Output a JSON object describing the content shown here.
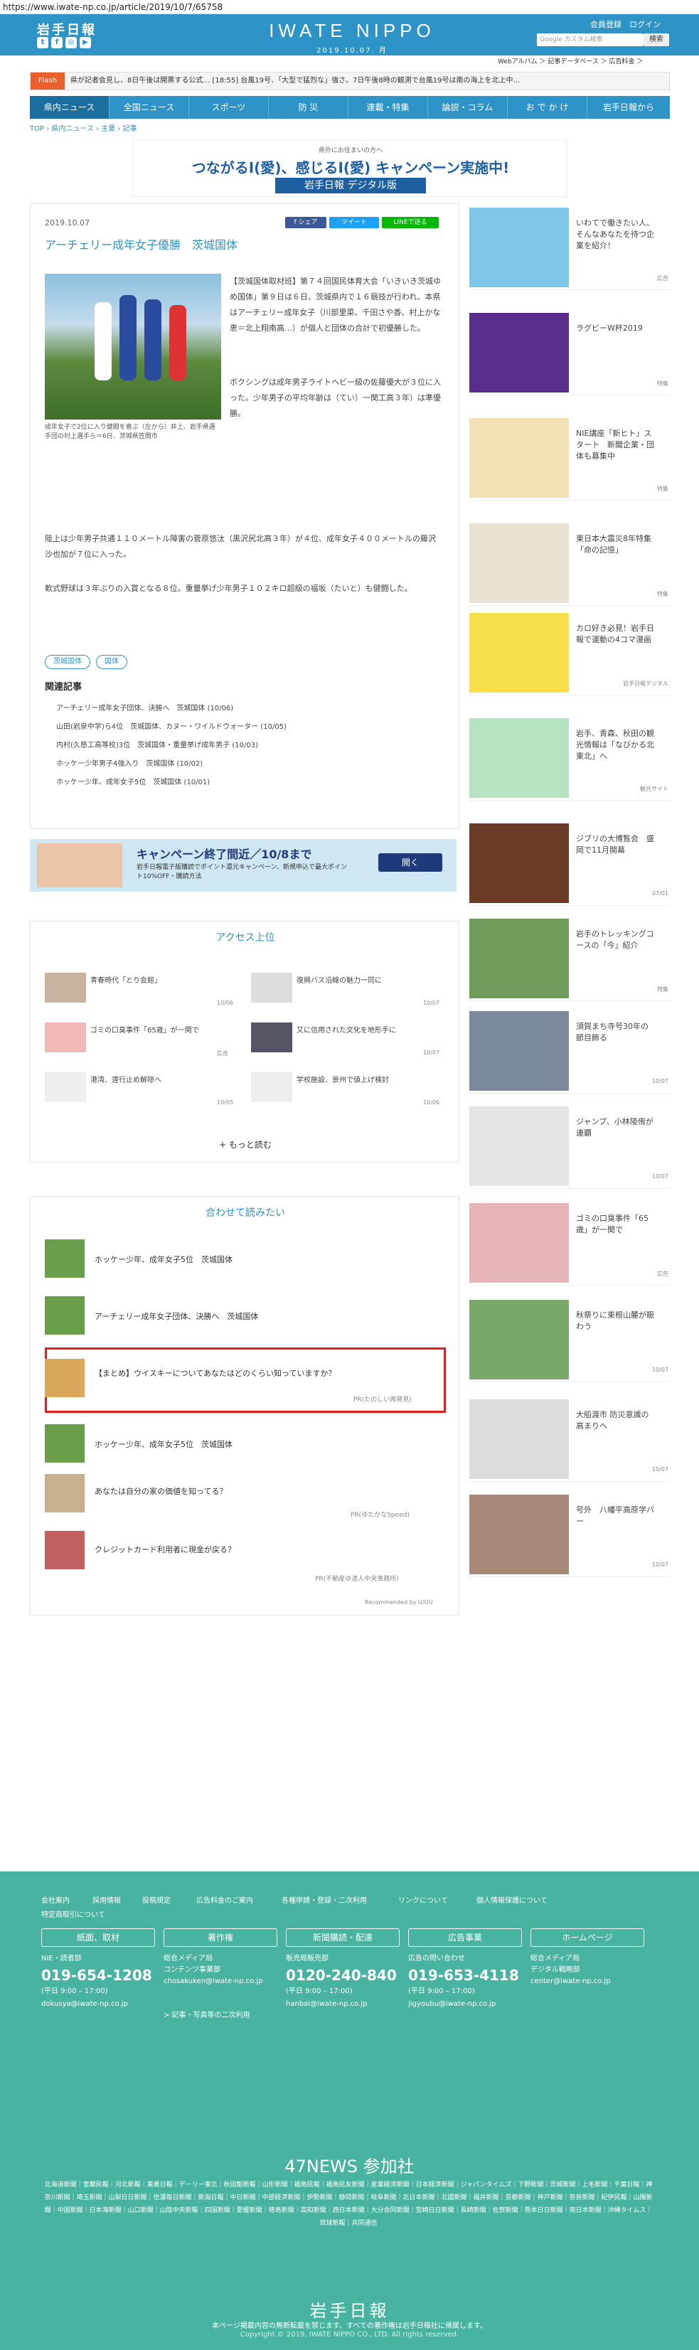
{
  "browser": {
    "url": "https://www.iwate-np.co.jp/article/2019/10/7/65758"
  },
  "header": {
    "logo": "岩手日報",
    "brand": "IWATE NIPPO",
    "date": "2019.10.07. 月",
    "member_label": "会員登録",
    "login_label": "ログイン",
    "search_placeholder": "Google カスタム検索",
    "search_button": "検索",
    "webmenu": "Webアルバム ＞ 記事データベース ＞ 広告料金 ＞"
  },
  "flash": {
    "label": "Flash",
    "text": "県が記者会見し、8日午後は開票する公式… [18:55] 台風19号、「大型で猛烈な」強さ。7日午後8時の観測で台風19号は南の海上を北上中…"
  },
  "nav": {
    "items": [
      "県内ニュース",
      "全国ニュース",
      "スポーツ",
      "防 災",
      "連載・特集",
      "論説・コラム",
      "お で か け",
      "岩手日報から"
    ]
  },
  "breadcrumb": "TOP › 県内ニュース › 主要 › 記事",
  "banner": {
    "top": "県外にお住まいの方へ",
    "main": "つながるI(愛)、感じるI(愛) キャンペーン実施中!",
    "sub": "岩手日報 デジタル版"
  },
  "article": {
    "date": "2019.10.07",
    "share_fb": "f シェア",
    "share_tw": "ツイート",
    "share_line": "LINEで送る",
    "title": "アーチェリー成年女子優勝　茨城国体",
    "caption": "成年女子で2位に入り健闘を喜ぶ（左から）井上、岩手県選手団の村上選手ら＝6日、茨城県笠間市",
    "paragraphs": [
      "【茨城国体取材班】第７４回国民体育大会「いきいき茨城ゆめ国体」第９日は６日、茨城県内で１６競技が行われ、本県はアーチェリー成年女子（川部里菜、千田さや香、村上かな恵＝北上翔南高…）が個人と団体の合計で初優勝した。",
      "ボクシングは成年男子ライトヘビー級の佐藤優大が３位に入った。少年男子の平均年齢は（てい）一関工高３年）は準優勝。",
      "陸上は少年男子共通１１０メートル障害の菅原悠汰（黒沢尻北高３年）が４位、成年女子４００メートルの藤沢沙也加が７位に入った。",
      "軟式野球は３年ぶりの入賞となる８位。重量挙げ少年男子１０２キロ超級の福坂（たいと）も健闘した。"
    ],
    "tags": [
      "茨城国体",
      "国体"
    ],
    "related_title": "関連記事",
    "related": [
      "アーチェリー成年女子団体、決勝へ　茨城国体 (10/06)",
      "山田(岩泉中学)ら4位　茨城国体、カヌー・ワイルドウォーター (10/05)",
      "内村(久慈工高等校)3位　茨城国体・重量挙げ成年男子 (10/03)",
      "ホッケー少年男子4強入り　茨城国体 (10/02)",
      "ホッケー少年、成年女子5位　茨城国体 (10/01)"
    ]
  },
  "ad": {
    "title": "キャンペーン終了間近／10/8まで",
    "text": "岩手日報電子版購読でポイント還元キャンペーン、新規申込で最大ポイント10%OFF・購読方法",
    "button": "開く"
  },
  "access": {
    "title": "アクセス上位",
    "items": [
      {
        "text": "青春時代「とり会館」",
        "date": "10/06"
      },
      {
        "text": "復興バス沿線の魅力一同に",
        "date": "10/07"
      },
      {
        "text": "ゴミの口臭事件「65歳」が一関で",
        "date": "広告"
      },
      {
        "text": "又に信用された文化を地形手に",
        "date": "10/07"
      },
      {
        "text": "港湾、遠行止め解除へ",
        "date": "10/05"
      },
      {
        "text": "学校施設、景州で値上げ検討",
        "date": "10/06"
      }
    ],
    "more": "+ もっと読む"
  },
  "recommend": {
    "title": "合わせて読みたい",
    "items": [
      {
        "text": "ホッケー少年、成年女子5位　茨城国体",
        "pr": ""
      },
      {
        "text": "アーチェリー成年女子団体、決勝へ　茨城国体",
        "pr": ""
      },
      {
        "text": "【まとめ】ウイスキーについてあなたはどのくらい知っていますか？",
        "pr": "PR(たのしい再発見)"
      },
      {
        "text": "ホッケー少年、成年女子5位　茨城国体",
        "pr": ""
      },
      {
        "text": "あなたは自分の家の価値を知ってる？",
        "pr": "PR(ゆたかなSpeed)"
      },
      {
        "text": "クレジットカード利用者に現金が戻る？",
        "pr": "PR(不動産ゆ達人中央事務所)"
      }
    ],
    "footer": "Recommended by U/OU"
  },
  "sidebar": {
    "items": [
      {
        "text": "いわてで働きたい人、そんなあなたを待つ企業を紹介！",
        "meta": "広告"
      },
      {
        "text": "ラグビーW杯2019",
        "meta": "特集"
      },
      {
        "text": "NIE講座「新ヒト」スタート　新聞企業・団体も募集中",
        "meta": "特集"
      },
      {
        "text": "東日本大震災8年特集「命の記憶」",
        "meta": "特集"
      },
      {
        "text": "カロ好き必見！岩手日報で運動の4コマ漫画",
        "meta": "岩手日報デジタル"
      },
      {
        "text": "岩手、青森、秋田の観光情報は「なびかる北東北」へ",
        "meta": "観光サイト"
      },
      {
        "text": "ジブリの大博覧会　盛岡で11月開幕",
        "meta": "07/01"
      },
      {
        "text": "岩手のトレッキングコースの「今」紹介",
        "meta": "特集"
      },
      {
        "text": "須賀まち寺号30年の節目飾る",
        "meta": "10/07"
      },
      {
        "text": "ジャンプ、小林陵侑が連覇",
        "meta": "10/07"
      },
      {
        "text": "ゴミの口臭事件「65歳」が一関で",
        "meta": "広告"
      },
      {
        "text": "秋祭りに東根山麓が賑わう",
        "meta": "10/07"
      },
      {
        "text": "大船渡市 防災意識の高まりへ",
        "meta": "10/07"
      },
      {
        "text": "号外　八幡平高原学バー",
        "meta": "10/07"
      }
    ]
  },
  "footer": {
    "links": [
      "会社案内",
      "採用情報",
      "投稿規定",
      "広告料金のご案内",
      "各種申請・登録・二次利用",
      "リンクについて",
      "個人情報保護について",
      "特定商取引について"
    ],
    "cols": [
      {
        "head": "紙面、取材",
        "l1": "NIE・読者部",
        "tel": "019-654-1208",
        "l2": "(平日 9:00 – 17:00)",
        "mail": "dokusya@iwate-np.co.jp"
      },
      {
        "head": "著作権",
        "l1": "総合メディア局",
        "tel": "コンテンツ事業部",
        "l2": "chosakuken@iwate-np.co.jp",
        "mail": "> 記事・写真等の二次利用"
      },
      {
        "head": "新聞購読・配達",
        "l1": "販売局販売部",
        "tel": "0120-240-840",
        "l2": "(平日 9:00 – 17:00)",
        "mail": "hanbai@iwate-np.co.jp"
      },
      {
        "head": "広告事業",
        "l1": "広告の問い合わせ",
        "tel": "019-653-4118",
        "l2": "(平日 9:00 – 17:00)",
        "mail": "jigyoubu@iwate-np.co.jp"
      },
      {
        "head": "ホームページ",
        "l1": "総合メディア局",
        "tel": "デジタル戦略部",
        "l2": "center@iwate-np.co.jp",
        "mail": ""
      }
    ],
    "n47": "47NEWS 参加社",
    "n47list": "北海道新聞｜室蘭民報｜河北新報｜東奥日報｜デーリー東北｜秋田魁新報｜山形新聞｜福島民報｜福島民友新聞｜産業経済新聞｜日本経済新聞｜ジャパンタイムズ｜下野新聞｜茨城新聞｜上毛新聞｜千葉日報｜神奈川新聞｜埼玉新聞｜山梨日日新聞｜信濃毎日新聞｜新潟日報｜中日新聞｜中部経済新聞｜伊勢新聞｜静岡新聞｜岐阜新聞｜北日本新聞｜北國新聞｜福井新聞｜京都新聞｜神戸新聞｜奈良新聞｜紀伊民報｜山陽新聞｜中国新聞｜日本海新聞｜山口新聞｜山陰中央新報｜四国新聞｜愛媛新聞｜徳島新聞｜高知新聞｜西日本新聞｜大分合同新聞｜宮崎日日新聞｜長崎新聞｜佐賀新聞｜熊本日日新聞｜南日本新聞｜沖縄タイムス｜琉球新報｜共同通信",
    "logo": "岩手日報",
    "note": "本ページ掲載内容の無断転載を禁じます。すべての著作権は岩手日報社に帰属します。",
    "copy": "Copyright © 2019, IWATE NIPPO CO., LTD. All rights reserved."
  }
}
